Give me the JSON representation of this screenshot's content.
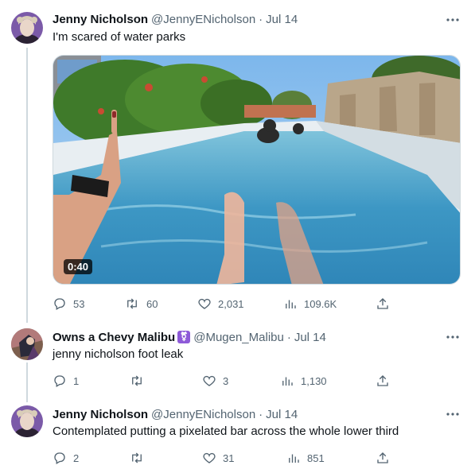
{
  "colors": {
    "text": "#0f1419",
    "muted": "#536471",
    "border": "#eff3f4",
    "thread": "#cfd9de",
    "badge": "#8e5ad8"
  },
  "tweets": [
    {
      "name": "Jenny Nicholson",
      "handle": "@JennyENicholson",
      "sep": "·",
      "date": "Jul 14",
      "text": "I'm scared of water parks",
      "avatar": "avatar-jenny",
      "media": {
        "type": "video",
        "duration": "0:40"
      },
      "actions": {
        "replies": "53",
        "retweets": "60",
        "likes": "2,031",
        "views": "109.6K"
      }
    },
    {
      "name": "Owns a Chevy Malibu",
      "badge": "⚧",
      "handle": "@Mugen_Malibu",
      "sep": "·",
      "date": "Jul 14",
      "text": "jenny nicholson foot leak",
      "avatar": "avatar-mugen",
      "actions": {
        "replies": "1",
        "retweets": "",
        "likes": "3",
        "views": "1,130"
      }
    },
    {
      "name": "Jenny Nicholson",
      "handle": "@JennyENicholson",
      "sep": "·",
      "date": "Jul 14",
      "text": "Contemplated putting a pixelated bar across the whole lower third",
      "avatar": "avatar-jenny",
      "actions": {
        "replies": "2",
        "retweets": "",
        "likes": "31",
        "views": "851"
      }
    }
  ],
  "icons": {
    "more": "more-dots-icon",
    "reply": "reply-icon",
    "retweet": "retweet-icon",
    "like": "heart-icon",
    "views": "views-icon",
    "share": "share-icon"
  }
}
